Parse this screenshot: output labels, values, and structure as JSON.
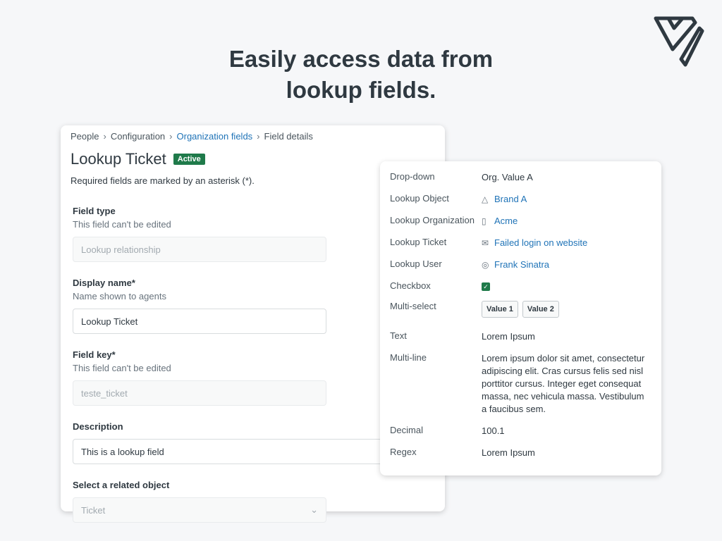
{
  "headline": {
    "line1": "Easily access data from",
    "line2": "lookup fields."
  },
  "breadcrumb": [
    "People",
    "Configuration",
    "Organization fields",
    "Field details"
  ],
  "page": {
    "title": "Lookup Ticket",
    "status": "Active",
    "required_note": "Required fields are marked by an asterisk (*)."
  },
  "fields": [
    {
      "label": "Field type",
      "hint": "This field can't be edited",
      "value": "Lookup relationship"
    },
    {
      "label": "Display name*",
      "hint": "Name shown to agents",
      "value": "Lookup Ticket"
    },
    {
      "label": "Field key*",
      "hint": "This field can't be edited",
      "value": "teste_ticket"
    },
    {
      "label": "Description",
      "value": "This is a lookup field"
    },
    {
      "label": "Select a related object",
      "value": "Ticket"
    }
  ],
  "details": [
    {
      "key": "Drop-down",
      "value": "Org. Value A"
    },
    {
      "key": "Lookup Object",
      "value": "Brand A",
      "icon": "shapes-icon"
    },
    {
      "key": "Lookup Organization",
      "value": "Acme",
      "icon": "building-icon"
    },
    {
      "key": "Lookup Ticket",
      "value": "Failed login on website",
      "icon": "envelope-icon"
    },
    {
      "key": "Lookup User",
      "value": "Frank Sinatra",
      "icon": "user-circle-icon"
    },
    {
      "key": "Checkbox",
      "checked": true
    },
    {
      "key": "Multi-select",
      "tags": [
        "Value 1",
        "Value 2"
      ]
    },
    {
      "key": "Text",
      "value": "Lorem Ipsum"
    },
    {
      "key": "Multi-line",
      "value": "Lorem ipsum dolor sit amet, consectetur adipiscing elit. Cras cursus felis sed nisl porttitor cursus. Integer eget consequat massa, nec vehicula massa. Vestibulum a faucibus sem."
    },
    {
      "key": "Decimal",
      "value": "100.1"
    },
    {
      "key": "Regex",
      "value": "Lorem Ipsum"
    }
  ],
  "colors": {
    "accent": "#1f73b7",
    "success": "#1f7a4a",
    "text": "#2f3941"
  }
}
